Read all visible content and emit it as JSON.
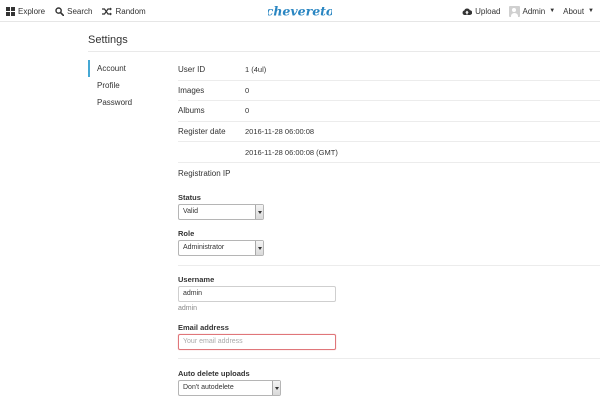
{
  "nav": {
    "explore": "Explore",
    "search": "Search",
    "random": "Random",
    "upload": "Upload",
    "user": "Admin",
    "about": "About"
  },
  "logo": {
    "text": "chevereto",
    "color": "#2a86c2"
  },
  "page": {
    "title": "Settings"
  },
  "side_menu": {
    "items": [
      {
        "label": "Account",
        "active": true
      },
      {
        "label": "Profile",
        "active": false
      },
      {
        "label": "Password",
        "active": false
      }
    ],
    "active_color": "#45a8d4"
  },
  "info": {
    "rows": [
      {
        "label": "User ID",
        "value": "1 (4ul)"
      },
      {
        "label": "Images",
        "value": "0"
      },
      {
        "label": "Albums",
        "value": "0"
      },
      {
        "label": "Register date",
        "value": "2016-11-28 06:00:08"
      },
      {
        "label": "",
        "value": "2016-11-28 06:00:08 (GMT)"
      },
      {
        "label": "Registration IP",
        "value": ""
      }
    ]
  },
  "form": {
    "status": {
      "label": "Status",
      "value": "Valid"
    },
    "role": {
      "label": "Role",
      "value": "Administrator"
    },
    "username": {
      "label": "Username",
      "value": "admin",
      "hint": "admin"
    },
    "email": {
      "label": "Email address",
      "placeholder": "Your email address",
      "value": ""
    },
    "auto_delete": {
      "label": "Auto delete uploads",
      "value": "Don't autodelete"
    }
  },
  "colors": {
    "focus_border": "#e0767a",
    "accent": "#45a8d4"
  },
  "icons": [
    "explore-icon",
    "search-icon",
    "random-icon",
    "upload-icon",
    "avatar",
    "caret-down-icon"
  ]
}
